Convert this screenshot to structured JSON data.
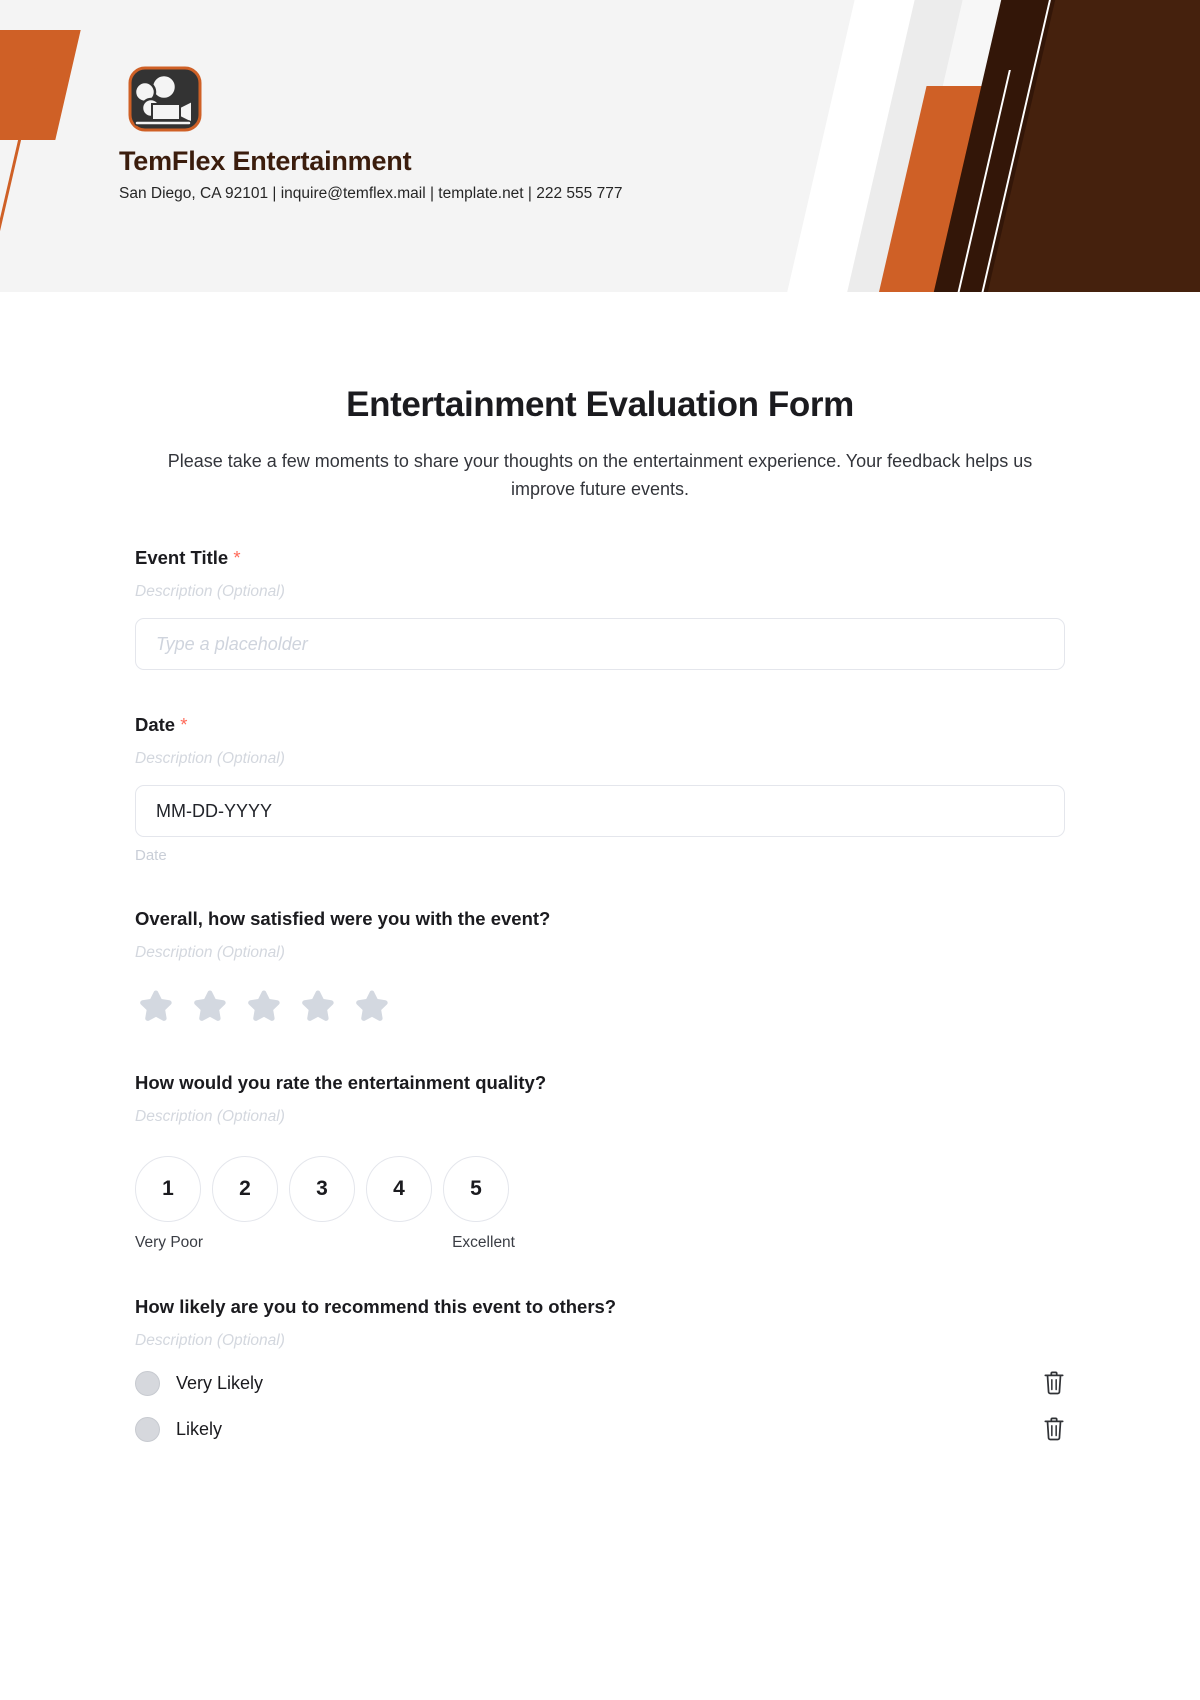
{
  "brand": {
    "name": "TemFlex Entertainment",
    "contact": "San Diego, CA 92101 | inquire@temflex.mail | template.net | 222 555 777",
    "logo_icon": "film-camera-icon",
    "accent_orange": "#cf6026",
    "dark_brown": "#45210d"
  },
  "form": {
    "title": "Entertainment Evaluation Form",
    "subtitle": "Please take a few moments to share your thoughts on the entertainment experience. Your feedback helps us improve future events.",
    "required_mark": "*",
    "description_placeholder": "Description (Optional)"
  },
  "fields": {
    "event_title": {
      "label": "Event Title",
      "required": true,
      "description": "Description (Optional)",
      "placeholder": "Type a placeholder"
    },
    "date": {
      "label": "Date",
      "required": true,
      "description": "Description (Optional)",
      "value": "MM-DD-YYYY",
      "helper": "Date"
    },
    "satisfaction": {
      "label": "Overall, how satisfied were you with the event?",
      "description": "Description (Optional)",
      "star_count": 5,
      "stars_selected": 0,
      "star_color": "#d3d8e0"
    },
    "quality": {
      "label": "How would you rate the entertainment quality?",
      "description": "Description (Optional)",
      "options": [
        "1",
        "2",
        "3",
        "4",
        "5"
      ],
      "low_label": "Very Poor",
      "high_label": "Excellent"
    },
    "recommend": {
      "label": "How likely are you to recommend this event to others?",
      "description": "Description (Optional)",
      "options": [
        {
          "label": "Very Likely",
          "delete_icon": "trash-icon"
        },
        {
          "label": "Likely",
          "delete_icon": "trash-icon"
        }
      ]
    }
  }
}
